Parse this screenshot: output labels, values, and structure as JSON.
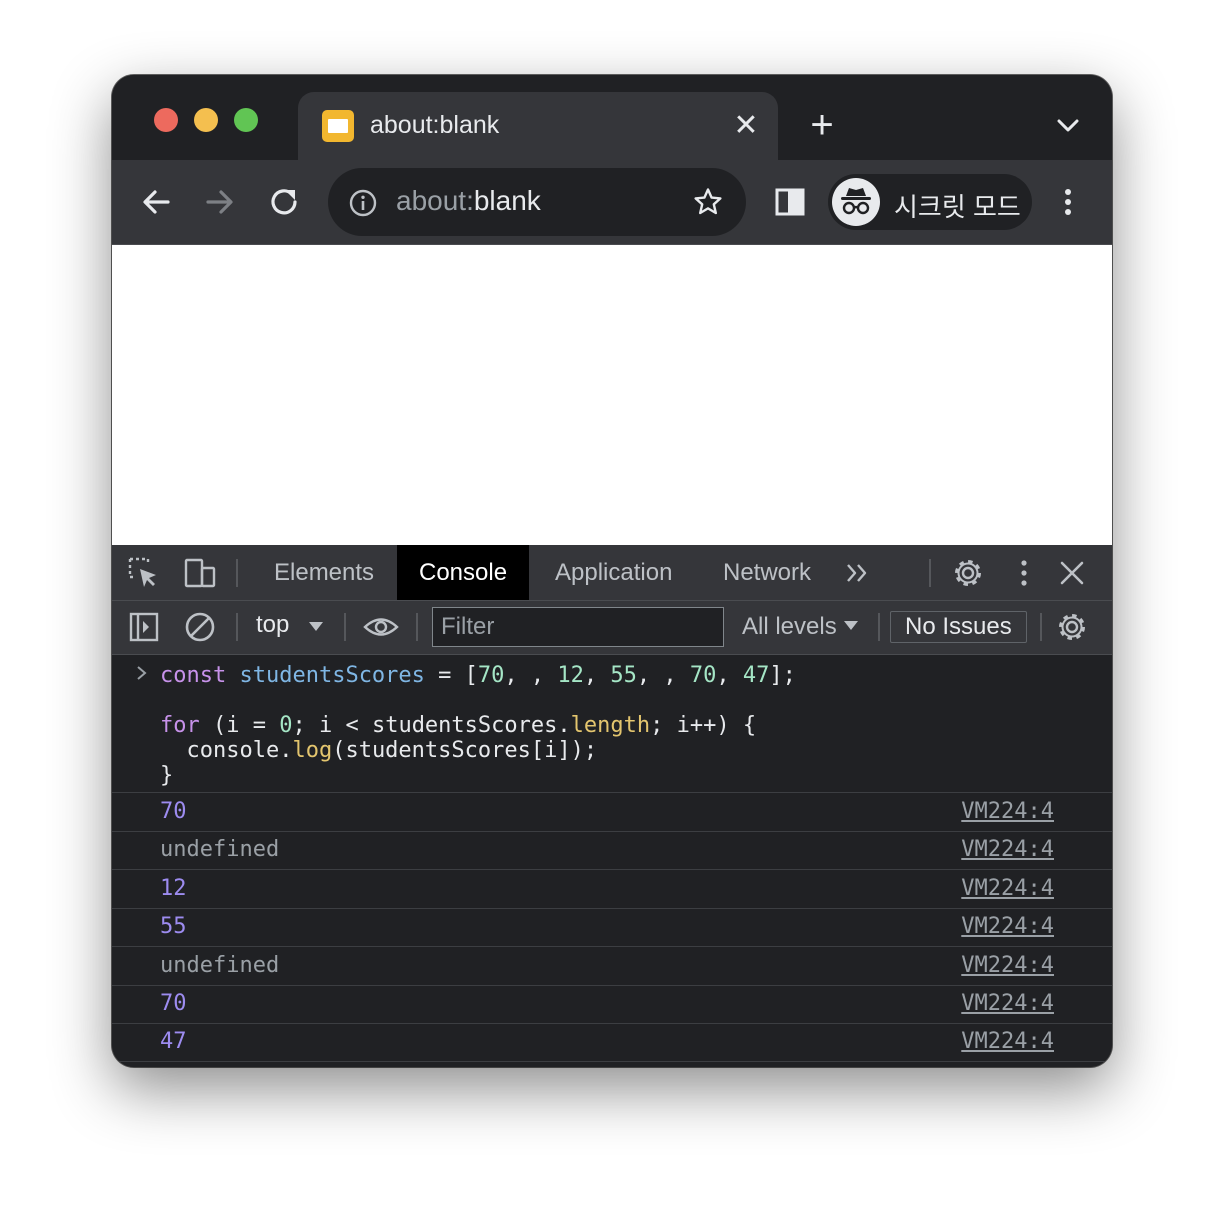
{
  "tab": {
    "title": "about:blank",
    "close_glyph": "✕",
    "new_tab_glyph": "+"
  },
  "omnibox": {
    "scheme": "about:",
    "host": "blank"
  },
  "incognito": {
    "label": "시크릿 모드"
  },
  "devtools": {
    "tabs": [
      "Elements",
      "Console",
      "Application",
      "Network"
    ],
    "active_tab": "Console",
    "more_tabs_glyph": "»",
    "context": "top",
    "filter_placeholder": "Filter",
    "levels_label": "All levels",
    "issues_label": "No Issues"
  },
  "console": {
    "input_lines": [
      "const studentsScores = [70, , 12, 55, , 70, 47];",
      "",
      "for (i = 0; i < studentsScores.length; i++) {",
      "  console.log(studentsScores[i]);",
      "}"
    ],
    "outputs": [
      {
        "value": "70",
        "type": "number",
        "source": "VM224:4"
      },
      {
        "value": "undefined",
        "type": "undefined",
        "source": "VM224:4"
      },
      {
        "value": "12",
        "type": "number",
        "source": "VM224:4"
      },
      {
        "value": "55",
        "type": "number",
        "source": "VM224:4"
      },
      {
        "value": "undefined",
        "type": "undefined",
        "source": "VM224:4"
      },
      {
        "value": "70",
        "type": "number",
        "source": "VM224:4"
      },
      {
        "value": "47",
        "type": "number",
        "source": "VM224:4"
      }
    ]
  },
  "colors": {
    "traffic_red": "#ed6a5e",
    "traffic_yellow": "#f4bf4f",
    "traffic_green": "#61c554",
    "number_output": "#9d8cf0",
    "keyword": "#c792ea"
  }
}
